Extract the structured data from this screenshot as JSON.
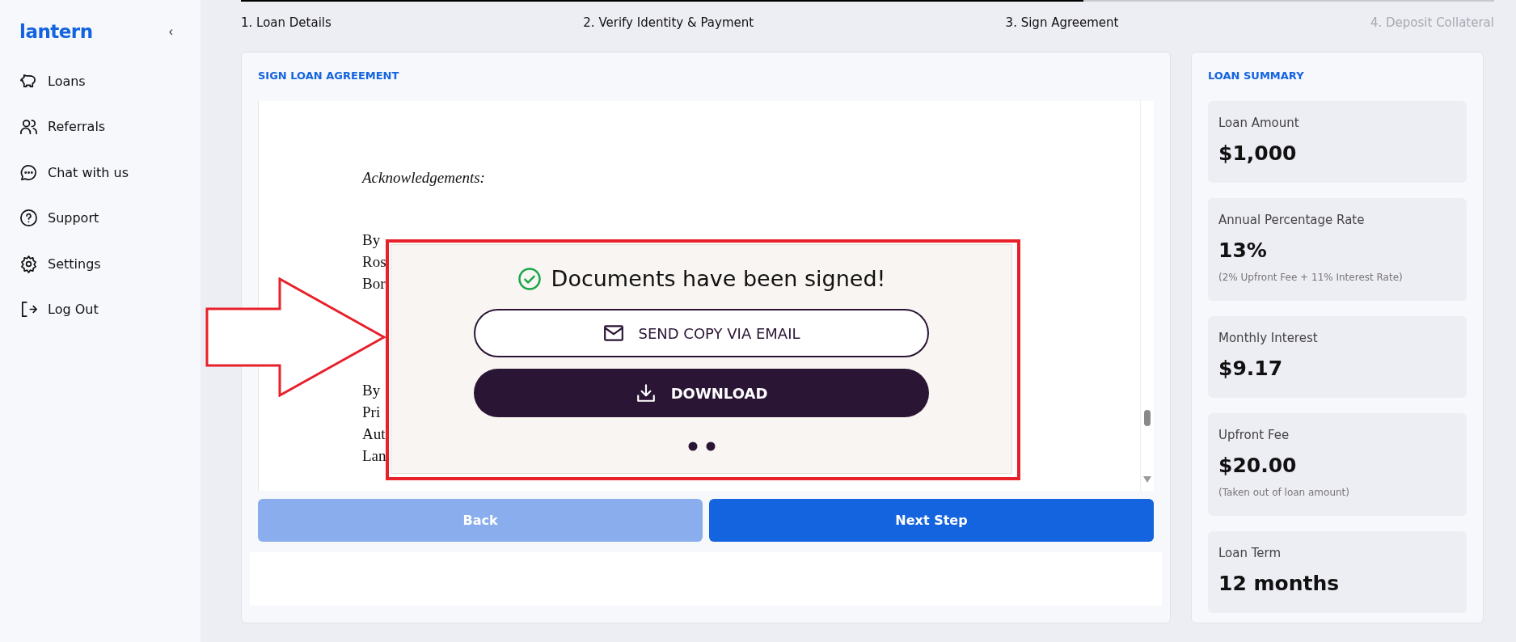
{
  "sidebar": {
    "logo": "lantern",
    "collapse": "‹",
    "items": [
      {
        "label": "Loans"
      },
      {
        "label": "Referrals"
      },
      {
        "label": "Chat with us"
      },
      {
        "label": "Support"
      },
      {
        "label": "Settings"
      },
      {
        "label": "Log Out"
      }
    ]
  },
  "steps": {
    "progress": {
      "level": 0.672
    },
    "items": [
      {
        "label": "1. Loan Details",
        "disabled": false
      },
      {
        "label": "2. Verify Identity & Payment",
        "disabled": false
      },
      {
        "label": "3. Sign Agreement",
        "disabled": false
      },
      {
        "label": "4. Deposit Collateral",
        "disabled": true
      }
    ]
  },
  "agreement": {
    "title": "SIGN LOAN AGREEMENT",
    "document": {
      "heading": "Acknowledgements:",
      "block_1": [
        "By",
        "Ros",
        "Bor"
      ],
      "block_2": [
        "By",
        "Pri",
        "Aut",
        "Lan"
      ]
    },
    "buttons": [
      {
        "label": "Back",
        "disabled": true
      },
      {
        "label": "Next Step",
        "disabled": false
      }
    ]
  },
  "dialog": {
    "title": "Documents have been signed!",
    "buttons": [
      {
        "label": "SEND COPY VIA EMAIL",
        "kind": "outline"
      },
      {
        "label": "DOWNLOAD",
        "kind": "filled"
      }
    ]
  },
  "summary": {
    "title": "LOAN SUMMARY",
    "items": [
      {
        "label": "Loan Amount",
        "value": "$1,000"
      },
      {
        "label": "Annual Percentage Rate",
        "value": "13%",
        "note": "(2% Upfront Fee + 11% Interest Rate)"
      },
      {
        "label": "Monthly Interest",
        "value": "$9.17"
      },
      {
        "label": "Upfront Fee",
        "value": "$20.00",
        "note": "(Taken out of loan amount)"
      },
      {
        "label": "Loan Term",
        "value": "12 months"
      }
    ]
  }
}
